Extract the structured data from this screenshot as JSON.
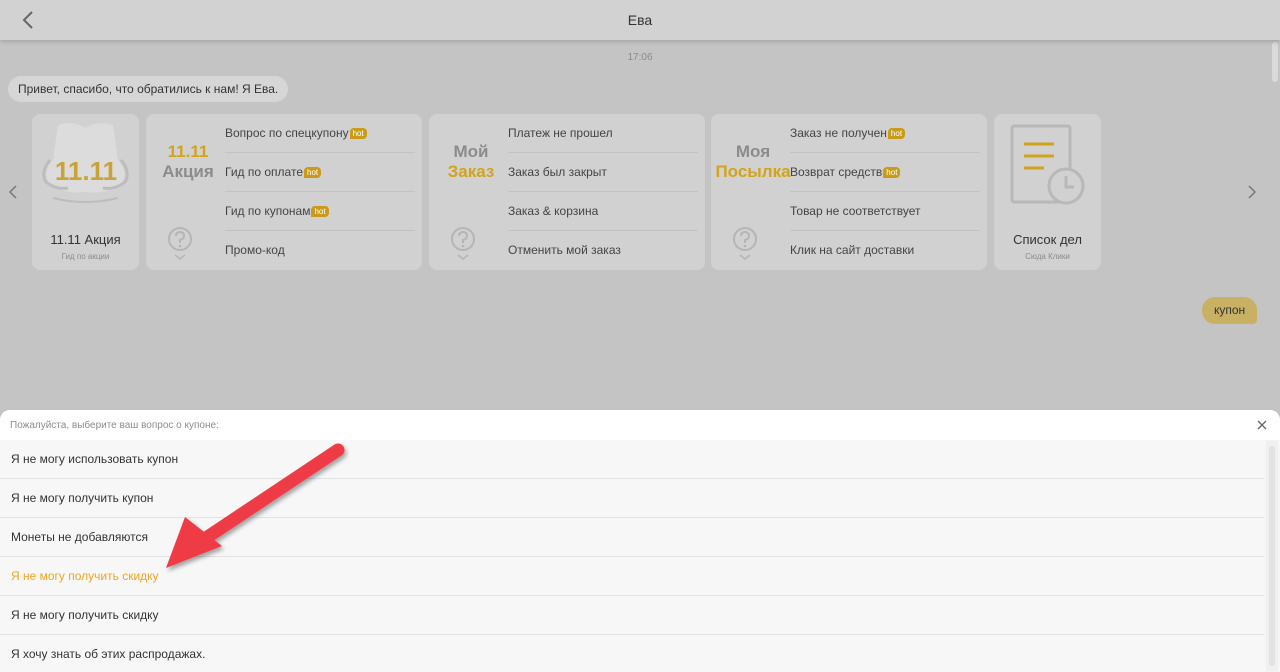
{
  "header": {
    "title": "Ева",
    "back_icon": "chevron-left-icon"
  },
  "chat": {
    "timestamp": "17:06",
    "bot_message": "Привет, спасибо, что обратились к нам! Я Ева.",
    "user_message": "купон"
  },
  "carousel": {
    "prev_icon": "chevron-left-icon",
    "next_icon": "chevron-right-icon",
    "promo_card": {
      "art_text": "11.11",
      "label": "11.11 Акция",
      "sub": "Гид по акции"
    },
    "cards": [
      {
        "head_line1": "11.11",
        "head_line2": "Акция",
        "links": [
          {
            "label": "Вопрос по спецкупону",
            "badge": "hot"
          },
          {
            "label": "Гид по оплате",
            "badge": "hot"
          },
          {
            "label": "Гид по купонам",
            "badge": "hot"
          },
          {
            "label": "Промо-код",
            "badge": ""
          }
        ]
      },
      {
        "head_line1": "Мой",
        "head_line2": "Заказ",
        "links": [
          {
            "label": "Платеж не прошел",
            "badge": ""
          },
          {
            "label": "Заказ был закрыт",
            "badge": ""
          },
          {
            "label": "Заказ & корзина",
            "badge": ""
          },
          {
            "label": "Отменить мой заказ",
            "badge": ""
          }
        ]
      },
      {
        "head_line1": "Моя",
        "head_line2": "Посылка",
        "links": [
          {
            "label": "Заказ не получен",
            "badge": "hot"
          },
          {
            "label": "Возврат средств",
            "badge": "hot"
          },
          {
            "label": "Товар не соответствует",
            "badge": ""
          },
          {
            "label": "Клик на сайт доставки",
            "badge": ""
          }
        ]
      }
    ],
    "todo_card": {
      "label": "Список дел",
      "sub": "Сюда Клики"
    }
  },
  "sheet": {
    "title": "Пожалуйста, выберите ваш вопрос о купоне:",
    "close_icon": "close-icon",
    "options": [
      "Я не могу использовать купон",
      "Я не могу получить купон",
      "Монеты не добавляются",
      "Я не могу получить скидку",
      "Я не могу получить скидку",
      "Я хочу знать об этих распродажах."
    ],
    "active_option_index": 3
  },
  "colors": {
    "accent": "#f0a51e",
    "gold": "#d2a31c",
    "user_bubble": "#c9b163",
    "annotation_arrow": "#ef3b45"
  }
}
